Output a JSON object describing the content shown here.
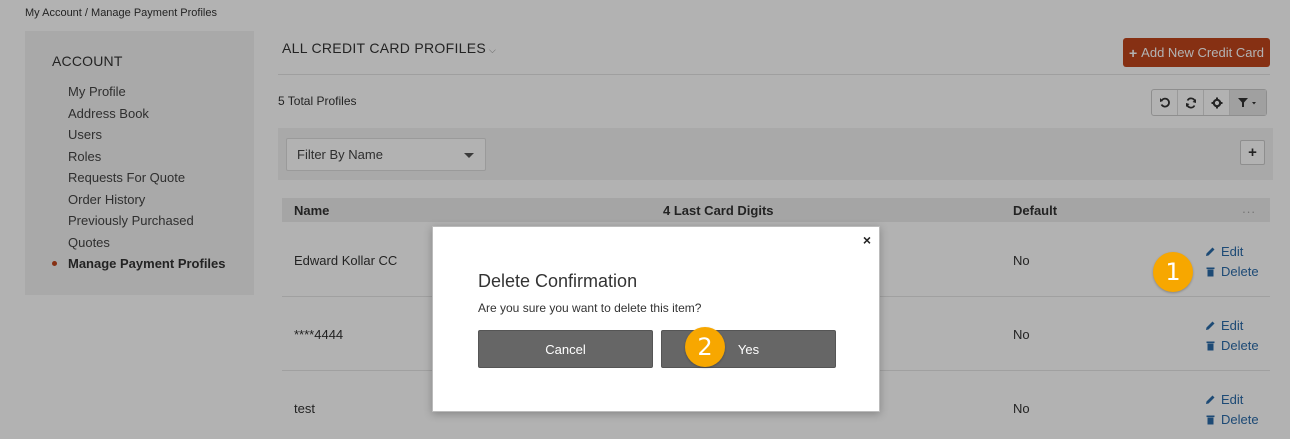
{
  "breadcrumb": "My Account / Manage Payment Profiles",
  "sidebar": {
    "heading": "ACCOUNT",
    "items": [
      {
        "label": "My Profile"
      },
      {
        "label": "Address Book"
      },
      {
        "label": "Users"
      },
      {
        "label": "Roles"
      },
      {
        "label": "Requests For Quote"
      },
      {
        "label": "Order History"
      },
      {
        "label": "Previously Purchased"
      },
      {
        "label": "Quotes"
      },
      {
        "label": "Manage Payment Profiles",
        "active": true
      }
    ]
  },
  "main": {
    "title": "ALL CREDIT CARD PROFILES",
    "add_button": "Add New Credit Card",
    "total": "5 Total Profiles",
    "filter_placeholder": "Filter By Name",
    "columns": {
      "name": "Name",
      "digits": "4 Last Card Digits",
      "default": "Default",
      "more": "..."
    },
    "rows": [
      {
        "name": "Edward Kollar CC",
        "digits": "",
        "default": "No",
        "edit": "Edit",
        "delete": "Delete"
      },
      {
        "name": "****4444",
        "digits": "",
        "default": "No",
        "edit": "Edit",
        "delete": "Delete"
      },
      {
        "name": "test",
        "digits": "",
        "default": "No",
        "edit": "Edit",
        "delete": "Delete"
      }
    ]
  },
  "modal": {
    "close": "×",
    "title": "Delete Confirmation",
    "message": "Are you sure you want to delete this item?",
    "cancel": "Cancel",
    "confirm": "Yes"
  },
  "markers": [
    "1",
    "2"
  ],
  "colors": {
    "accent": "#c0451c",
    "link": "#2a6aa8",
    "marker": "#f7a700",
    "modal_button": "#666666"
  },
  "icons": [
    "undo-icon",
    "refresh-icon",
    "gear-icon",
    "filter-icon",
    "plus-icon",
    "pencil-icon",
    "trash-icon",
    "close-icon"
  ]
}
